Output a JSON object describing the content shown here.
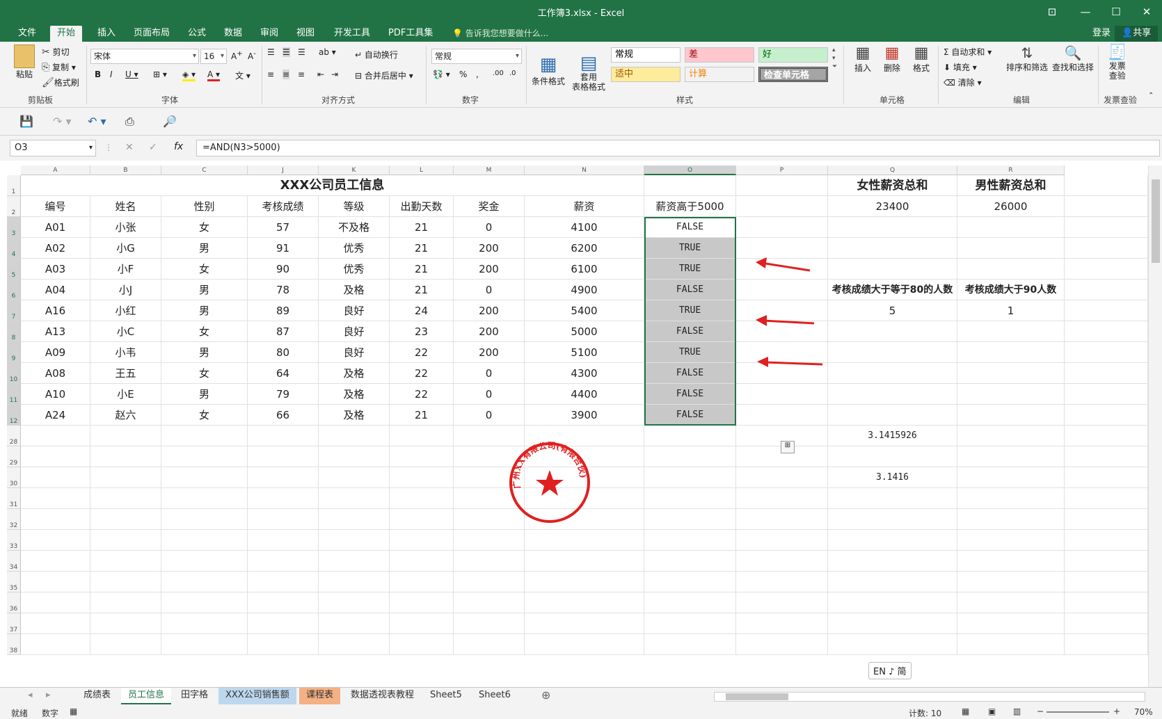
{
  "window": {
    "title": "工作簿3.xlsx - Excel"
  },
  "tabs": [
    "文件",
    "开始",
    "插入",
    "页面布局",
    "公式",
    "数据",
    "审阅",
    "视图",
    "开发工具",
    "PDF工具集"
  ],
  "tell_me": "告诉我您想要做什么...",
  "login": "登录",
  "share": "共享",
  "clipboard": {
    "paste": "粘贴",
    "cut": "剪切",
    "copy": "复制",
    "format_painter": "格式刷",
    "label": "剪贴板"
  },
  "font": {
    "name": "宋体",
    "size": "16",
    "label": "字体"
  },
  "align": {
    "wrap": "自动换行",
    "merge": "合并后居中",
    "label": "对齐方式"
  },
  "number": {
    "format": "常规",
    "label": "数字"
  },
  "styles": {
    "cond_format": "条件格式",
    "table_format": "套用\n表格格式",
    "normal": "常规",
    "bad": "差",
    "good": "好",
    "neutral": "适中",
    "calc": "计算",
    "check": "检查单元格",
    "label": "样式"
  },
  "cells": {
    "insert": "插入",
    "delete": "删除",
    "format": "格式",
    "label": "单元格"
  },
  "editing": {
    "autosum": "自动求和",
    "fill": "填充",
    "clear": "清除",
    "sort": "排序和筛选",
    "find": "查找和选择",
    "label": "编辑"
  },
  "invoice": {
    "check": "发票\n查验",
    "label": "发票查验"
  },
  "namebox": "O3",
  "formula": "=AND(N3>5000)",
  "columns": [
    "A",
    "B",
    "C",
    "J",
    "K",
    "L",
    "M",
    "N",
    "O",
    "P",
    "Q",
    "R"
  ],
  "row_numbers": [
    "1",
    "2",
    "3",
    "4",
    "5",
    "6",
    "7",
    "8",
    "9",
    "10",
    "11",
    "12",
    "28",
    "29",
    "30",
    "31",
    "32",
    "33",
    "34",
    "35",
    "36",
    "37",
    "38"
  ],
  "title_cell": "XXX公司员工信息",
  "headers": [
    "编号",
    "姓名",
    "性别",
    "考核成绩",
    "等级",
    "出勤天数",
    "奖金",
    "薪资",
    "薪资高于5000"
  ],
  "rows": [
    [
      "A01",
      "小张",
      "女",
      "57",
      "不及格",
      "21",
      "0",
      "4100",
      "FALSE"
    ],
    [
      "A02",
      "小G",
      "男",
      "91",
      "优秀",
      "21",
      "200",
      "6200",
      "TRUE"
    ],
    [
      "A03",
      "小F",
      "女",
      "90",
      "优秀",
      "21",
      "200",
      "6100",
      "TRUE"
    ],
    [
      "A04",
      "小J",
      "男",
      "78",
      "及格",
      "21",
      "0",
      "4900",
      "FALSE"
    ],
    [
      "A16",
      "小红",
      "男",
      "89",
      "良好",
      "24",
      "200",
      "5400",
      "TRUE"
    ],
    [
      "A13",
      "小C",
      "女",
      "87",
      "良好",
      "23",
      "200",
      "5000",
      "FALSE"
    ],
    [
      "A09",
      "小韦",
      "男",
      "80",
      "良好",
      "22",
      "200",
      "5100",
      "TRUE"
    ],
    [
      "A08",
      "王五",
      "女",
      "64",
      "及格",
      "22",
      "0",
      "4300",
      "FALSE"
    ],
    [
      "A10",
      "小E",
      "男",
      "79",
      "及格",
      "22",
      "0",
      "4400",
      "FALSE"
    ],
    [
      "A24",
      "赵六",
      "女",
      "66",
      "及格",
      "21",
      "0",
      "3900",
      "FALSE"
    ]
  ],
  "side": {
    "female_label": "女性薪资总和",
    "male_label": "男性薪资总和",
    "female_val": "23400",
    "male_val": "26000",
    "ge80_label": "考核成绩大于等于80的人数",
    "gt90_label": "考核成绩大于90人数",
    "ge80_val": "5",
    "gt90_val": "1",
    "pi1": "3.1415926",
    "pi2": "3.1416"
  },
  "stamp": {
    "text": "广州XX有限公司(有限合伙)"
  },
  "ime": "EN ♪ 简",
  "sheets": [
    "成绩表",
    "员工信息",
    "田字格",
    "XXX公司销售额",
    "课程表",
    "数据透视表教程",
    "Sheet5",
    "Sheet6"
  ],
  "status": {
    "ready": "就绪",
    "mode": "数字",
    "count": "计数: 10",
    "zoom": "70%"
  },
  "colors": {
    "excel_green": "#217346",
    "selection": "#c8c8c8",
    "arrow": "#e02020"
  }
}
